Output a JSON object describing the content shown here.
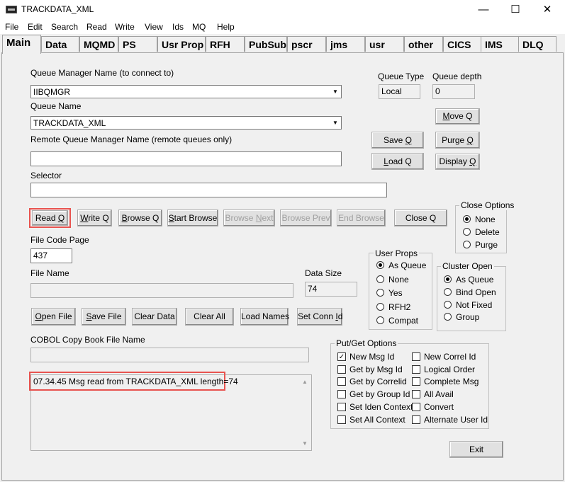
{
  "window": {
    "title": "TRACKDATA_XML",
    "minimize": "—",
    "maximize": "☐",
    "close": "✕"
  },
  "menu": [
    "File",
    "Edit",
    "Search",
    "Read",
    "Write",
    "View",
    "Ids",
    "MQ",
    "Help"
  ],
  "tabs": [
    "Main",
    "Data",
    "MQMD",
    "PS",
    "Usr Prop",
    "RFH",
    "PubSub",
    "pscr",
    "jms",
    "usr",
    "other",
    "CICS",
    "IMS",
    "DLQ"
  ],
  "main": {
    "qm_label": "Queue Manager Name (to connect to)",
    "qm_value": "IIBQMGR",
    "queue_type_label": "Queue Type",
    "queue_type_value": "Local",
    "queue_depth_label": "Queue depth",
    "queue_depth_value": "0",
    "queue_name_label": "Queue Name",
    "queue_name_value": "TRACKDATA_XML",
    "remote_qm_label": "Remote Queue Manager Name (remote queues only)",
    "remote_qm_value": "",
    "selector_label": "Selector",
    "selector_value": "",
    "file_code_page_label": "File Code Page",
    "file_code_page_value": "437",
    "file_name_label": "File Name",
    "file_name_value": "",
    "data_size_label": "Data Size",
    "data_size_value": "74",
    "cobol_label": "COBOL Copy Book File Name",
    "cobol_value": "",
    "message_log": "07.34.45 Msg read from TRACKDATA_XML length=74"
  },
  "buttons": {
    "move_q": {
      "u": "M",
      "rest": "ove Q"
    },
    "save_q": {
      "pre": "Save ",
      "u": "Q",
      "rest": ""
    },
    "purge_q": {
      "pre": "Purge ",
      "u": "Q",
      "rest": ""
    },
    "load_q": {
      "u": "L",
      "rest": "oad Q"
    },
    "display_q": {
      "pre": "Display ",
      "u": "Q",
      "rest": ""
    },
    "read_q": {
      "pre": "Read ",
      "u": "Q",
      "rest": ""
    },
    "write_q": {
      "u": "W",
      "rest": "rite Q"
    },
    "browse_q": {
      "u": "B",
      "rest": "rowse Q"
    },
    "start_browse": {
      "u": "S",
      "rest": "tart Browse"
    },
    "browse_next": {
      "pre": "Browse ",
      "u": "N",
      "rest": "ext"
    },
    "browse_prev": "Browse Prev",
    "end_browse": "End Browse",
    "close_q": "Close Q",
    "open_file": {
      "u": "O",
      "rest": "pen File"
    },
    "save_file": {
      "u": "S",
      "rest": "ave File"
    },
    "clear_data": "Clear Data",
    "clear_all": "Clear All",
    "load_names": "Load Names",
    "set_conn_id": {
      "pre": "Set Conn ",
      "u": "I",
      "rest": "d"
    },
    "exit": "Exit"
  },
  "close_options": {
    "title": "Close Options",
    "items": [
      "None",
      "Delete",
      "Purge"
    ],
    "selected": 0
  },
  "user_props": {
    "title": "User Props",
    "items": [
      "As Queue",
      "None",
      "Yes",
      "RFH2",
      "Compat"
    ],
    "selected": 0
  },
  "cluster_open": {
    "title": "Cluster Open",
    "items": [
      "As Queue",
      "Bind Open",
      "Not Fixed",
      "Group"
    ],
    "selected": 0
  },
  "put_get": {
    "title": "Put/Get Options",
    "left": [
      {
        "label": "New Msg Id",
        "checked": true
      },
      {
        "label": "Get by Msg Id",
        "checked": false
      },
      {
        "label": "Get by Correlid",
        "checked": false
      },
      {
        "label": "Get by Group Id",
        "checked": false
      },
      {
        "label": "Set Iden Context",
        "checked": false
      },
      {
        "label": "Set All Context",
        "checked": false
      }
    ],
    "right": [
      {
        "label": "New Correl Id",
        "checked": false
      },
      {
        "label": "Logical Order",
        "checked": false
      },
      {
        "label": "Complete Msg",
        "checked": false
      },
      {
        "label": "All Avail",
        "checked": false
      },
      {
        "label": "Convert",
        "checked": false
      },
      {
        "label": "Alternate User Id",
        "checked": false
      }
    ]
  },
  "colors": {
    "highlight": "#e8534f",
    "background": "#f0f0f0"
  }
}
